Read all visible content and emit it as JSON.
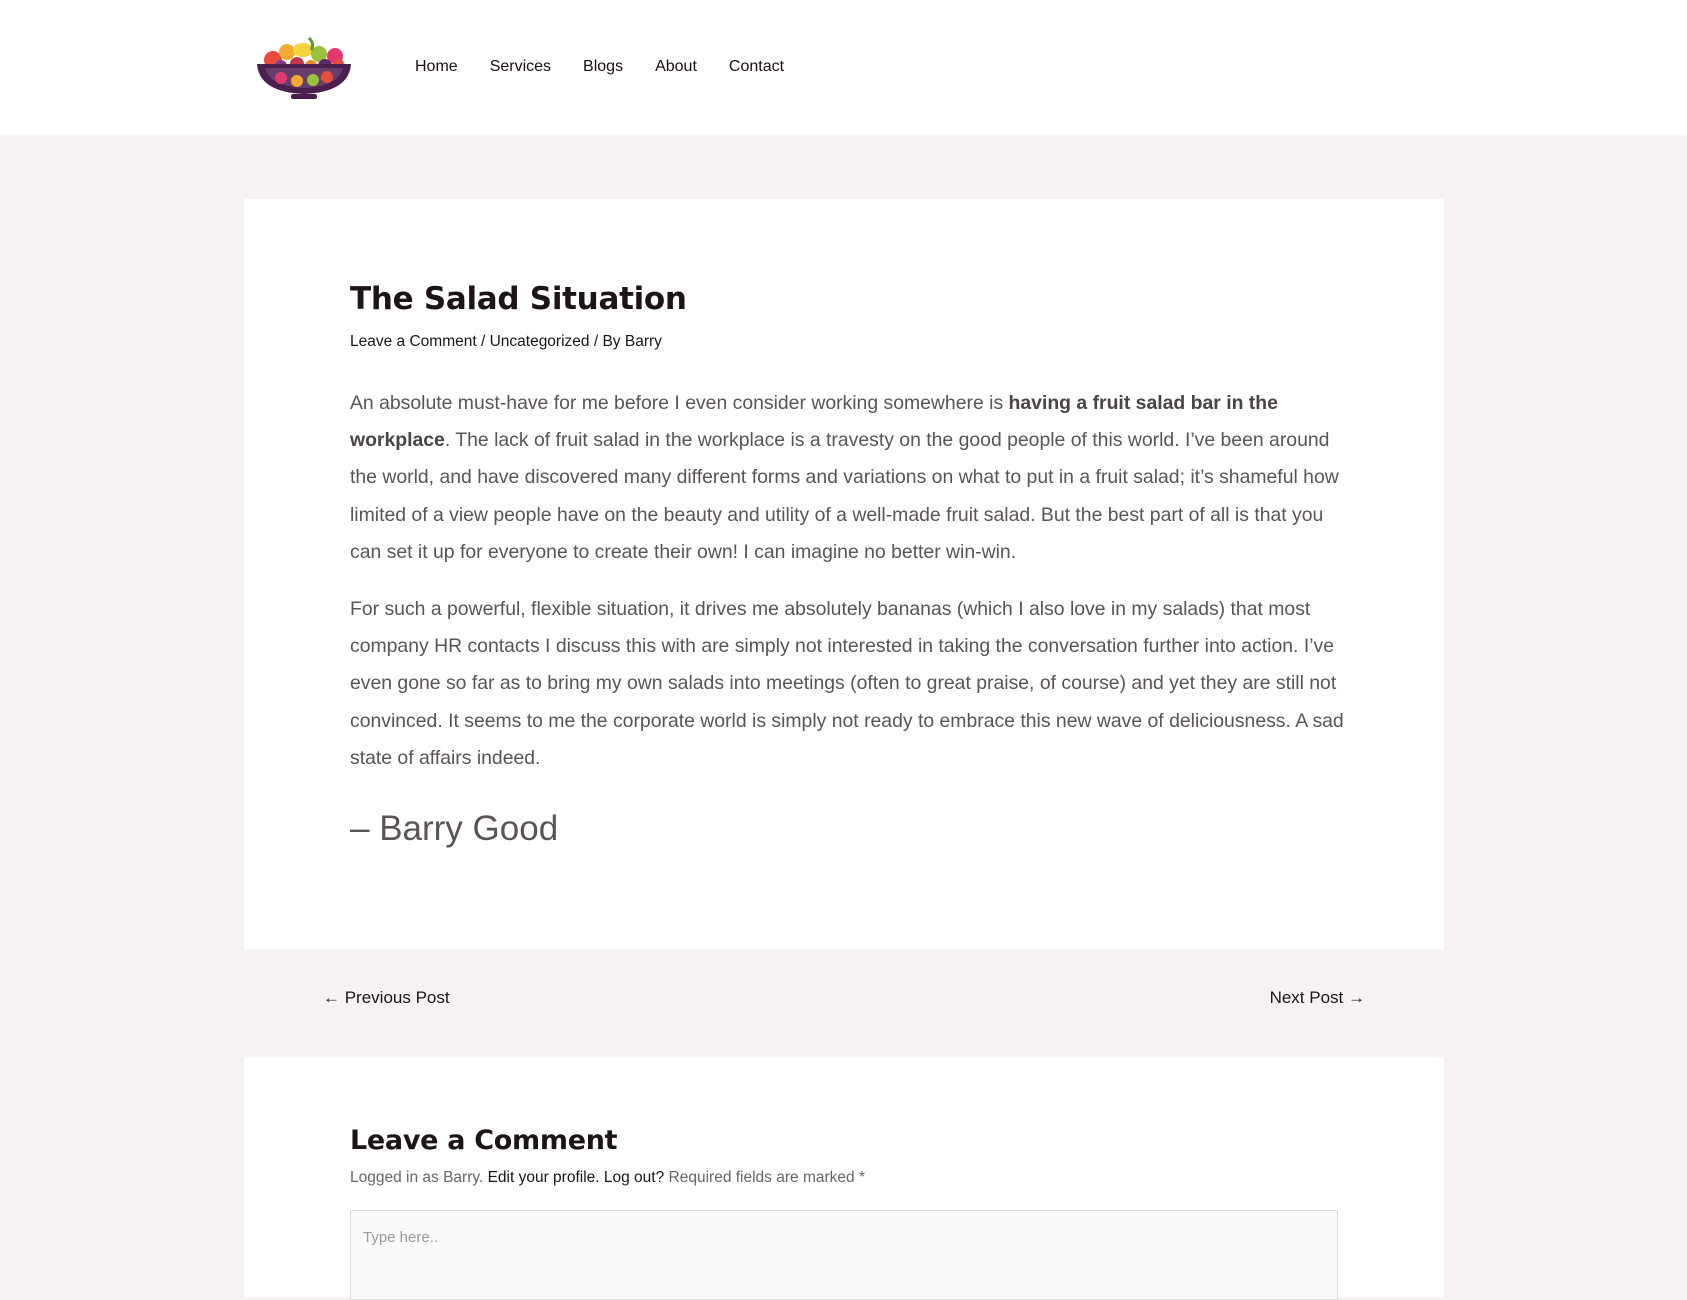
{
  "header": {
    "logo_alt": "Fruit salad bowl logo",
    "nav": [
      {
        "label": "Home"
      },
      {
        "label": "Services"
      },
      {
        "label": "Blogs"
      },
      {
        "label": "About"
      },
      {
        "label": "Contact"
      }
    ]
  },
  "article": {
    "title": "The Salad Situation",
    "meta": {
      "comment_link": "Leave a Comment",
      "sep1": " / ",
      "category": "Uncategorized",
      "sep2": " / By ",
      "author": "Barry"
    },
    "p1_before": "An absolute must-have for me before I even consider working somewhere is ",
    "p1_bold": "having a fruit salad bar in the workplace",
    "p1_after": ". The lack of fruit salad in the workplace is a travesty on the good people of this world. I’ve been around the world, and have discovered many different forms and variations on what to put in a fruit salad; it’s shameful how limited of a view people have on the beauty and utility of a well-made fruit salad. But the best part of all is that you can set it up for everyone to create their own! I can imagine no better win-win.",
    "p2": "For such a powerful, flexible situation, it drives me absolutely bananas (which I also love in my salads) that most company HR contacts I discuss this with are simply not interested in taking the conversation further into action. I’ve even gone so far as to bring my own salads into meetings (often to great praise, of course) and yet they are still not convinced. It seems to me the corporate world is simply not ready to embrace this new wave of deliciousness. A sad state of affairs indeed.",
    "signature": "– Barry Good"
  },
  "post_nav": {
    "prev": "← Previous Post",
    "next": "Next Post →"
  },
  "comments": {
    "title": "Leave a Comment",
    "logged_in_prefix": "Logged in as Barry. ",
    "edit_profile": "Edit your profile.",
    "space": " ",
    "log_out": "Log out?",
    "required": " Required fields are marked *",
    "placeholder": "Type here.."
  }
}
